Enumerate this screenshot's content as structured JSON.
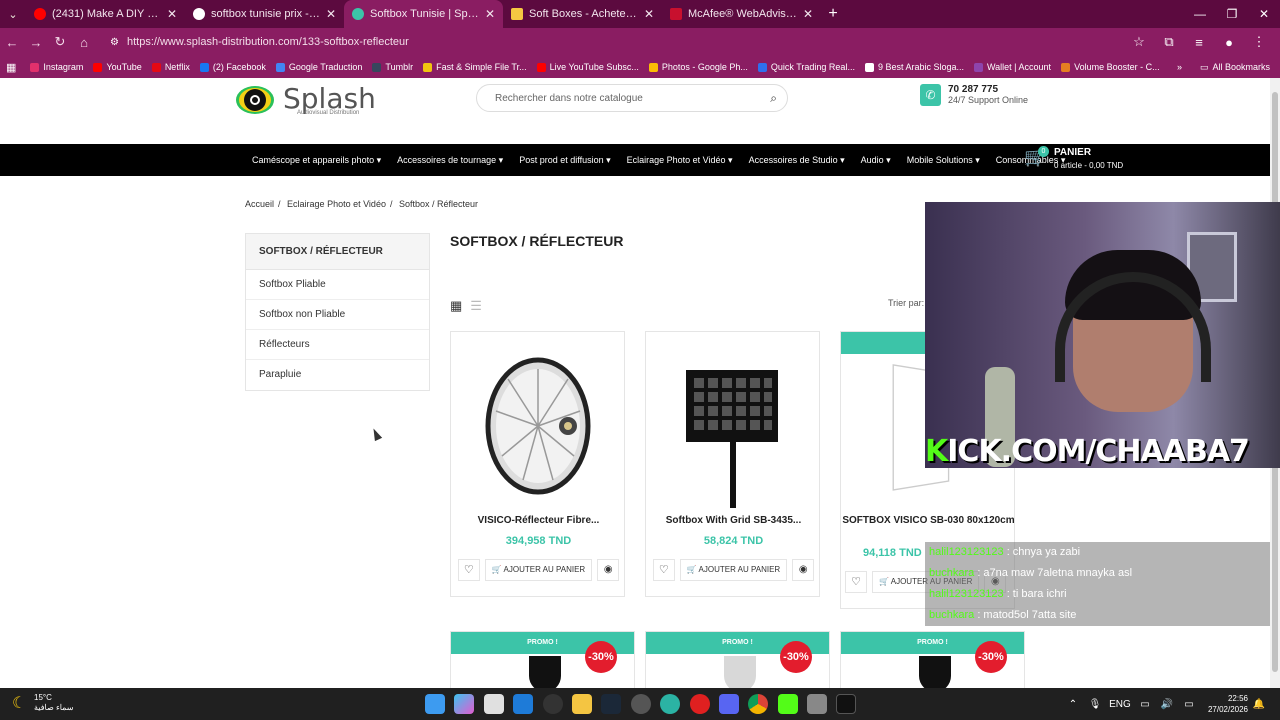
{
  "browser": {
    "tabs": [
      {
        "title": "(2431) Make A DIY SOFTBOX Vi",
        "color": "#ff0000"
      },
      {
        "title": "softbox tunisie prix - Google Se",
        "color": "#ffffff"
      },
      {
        "title": "Softbox Tunisie | Splash Distrib",
        "color": "#3cc4a8"
      },
      {
        "title": "Soft Boxes - Achetez Lighting S",
        "color": "#f5c842"
      },
      {
        "title": "McAfee® WebAdvisor - Websi",
        "color": "#c8102e"
      }
    ],
    "url": "https://www.splash-distribution.com/133-softbox-reflecteur",
    "bookmarks": [
      {
        "label": "Instagram",
        "color": "#e1306c"
      },
      {
        "label": "YouTube",
        "color": "#ff0000"
      },
      {
        "label": "Netflix",
        "color": "#e50914"
      },
      {
        "label": "(2) Facebook",
        "color": "#1877f2"
      },
      {
        "label": "Google Traduction",
        "color": "#4285f4"
      },
      {
        "label": "Tumblr",
        "color": "#36465d"
      },
      {
        "label": "Fast & Simple File Tr...",
        "color": "#f1c40f"
      },
      {
        "label": "Live YouTube Subsc...",
        "color": "#ff0000"
      },
      {
        "label": "Photos - Google Ph...",
        "color": "#fbbc05"
      },
      {
        "label": "Quick Trading Real...",
        "color": "#2f6fed"
      },
      {
        "label": "9 Best Arabic Sloga...",
        "color": "#ffffff"
      },
      {
        "label": "Wallet | Account",
        "color": "#8e44ad"
      },
      {
        "label": "Volume Booster - C...",
        "color": "#e67e22"
      }
    ],
    "all_bookmarks": "All Bookmarks"
  },
  "site": {
    "logo_word": "Splash",
    "logo_sub": "Audiovisual Distribution",
    "search_placeholder": "Rechercher dans notre catalogue",
    "phone": "70 287 775",
    "support": "24/7 Support Online",
    "menu": [
      "Caméscope et appareils photo",
      "Accessoires de tournage",
      "Post prod et diffusion",
      "Eclairage Photo et Vidéo",
      "Accessoires de Studio",
      "Audio",
      "Mobile Solutions",
      "Consommables"
    ],
    "cart": {
      "count": "0",
      "label": "PANIER",
      "summary": "0 article - 0,00 TND"
    },
    "breadcrumb": [
      "Accueil",
      "Eclairage Photo et Vidéo",
      "Softbox / Réflecteur"
    ],
    "category_title": "SOFTBOX / RÉFLECTEUR",
    "subcategories": [
      "Softbox Pliable",
      "Softbox non Pliable",
      "Réflecteurs",
      "Parapluie"
    ],
    "page_title": "SOFTBOX / RÉFLECTEUR",
    "sort_label": "Trier par:",
    "products": [
      {
        "name": "VISICO-Réflecteur Fibre...",
        "price": "394,958 TND",
        "add": "AJOUTER AU PANIER"
      },
      {
        "name": "Softbox With Grid SB-3435...",
        "price": "58,824 TND",
        "add": "AJOUTER AU PANIER"
      },
      {
        "name": "SOFTBOX VISICO SB-030 80x120cm",
        "price": "94,118 TND",
        "add": "AJOUTER AU PANIER"
      }
    ],
    "promos": [
      {
        "label": "PROMO !",
        "discount": "-30%"
      },
      {
        "label": "PROMO !",
        "discount": "-30%"
      },
      {
        "label": "PROMO !",
        "discount": "-30%"
      }
    ]
  },
  "stream": {
    "overlay_k": "K",
    "overlay_rest": "ICK.COM/CHAABA7",
    "chat": [
      {
        "user": "halil123123123",
        "msg": " : chnya ya zabi"
      },
      {
        "user": "buchkara",
        "msg": " : a7na maw 7aletna mnayka asl"
      },
      {
        "user": "halil123123123",
        "msg": " : ti bara ichri"
      },
      {
        "user": "buchkara",
        "msg": " : matod5ol 7atta site"
      }
    ]
  },
  "taskbar": {
    "temp": "15°C",
    "weather": "سماء صافية",
    "lang": "ENG",
    "time": "22:56",
    "date": "27/02/2026"
  }
}
